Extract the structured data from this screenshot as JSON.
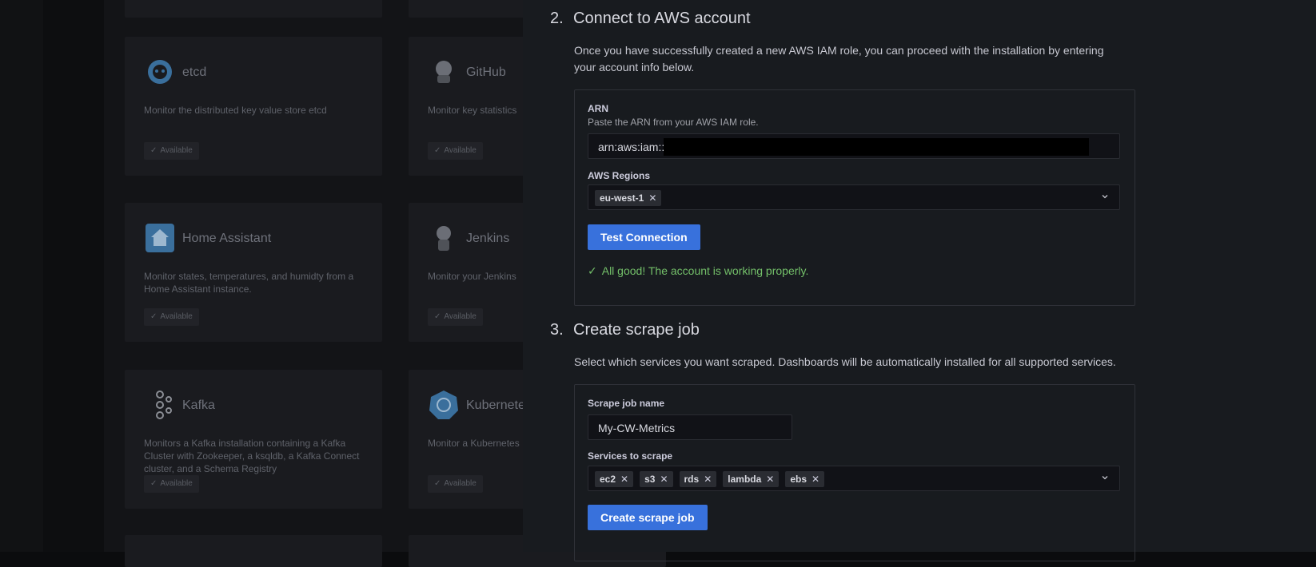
{
  "catalog": {
    "cards": [
      {
        "title": "etcd",
        "desc": "Monitor the distributed key value store etcd",
        "badge": "Available"
      },
      {
        "title": "GitHub",
        "desc": "Monitor key statistics",
        "badge": "Available"
      },
      {
        "title": "Home Assistant",
        "desc": "Monitor states, temperatures, and humidty from a Home Assistant instance.",
        "badge": "Available"
      },
      {
        "title": "Jenkins",
        "desc": "Monitor your Jenkins",
        "badge": "Available"
      },
      {
        "title": "Kafka",
        "desc": "Monitors a Kafka installation containing a Kafka Cluster with Zookeeper, a ksqldb, a Kafka Connect cluster, and a Schema Registry",
        "badge": "Available"
      },
      {
        "title": "Kubernete",
        "desc": "Monitor a Kubernetes",
        "badge": "Available"
      }
    ]
  },
  "step2": {
    "number": "2.",
    "title": "Connect to AWS account",
    "description": "Once you have successfully created a new AWS IAM role, you can proceed with the installation by entering your account info below.",
    "arn_label": "ARN",
    "arn_hint": "Paste the ARN from your AWS IAM role.",
    "arn_value": "arn:aws:iam::",
    "regions_label": "AWS Regions",
    "regions": [
      "eu-west-1"
    ],
    "test_button": "Test Connection",
    "success_message": "All good! The account is working properly."
  },
  "step3": {
    "number": "3.",
    "title": "Create scrape job",
    "description": "Select which services you want scraped. Dashboards will be automatically installed for all supported services.",
    "job_name_label": "Scrape job name",
    "job_name_value": "My-CW-Metrics",
    "services_label": "Services to scrape",
    "services": [
      "ec2",
      "s3",
      "rds",
      "lambda",
      "ebs"
    ],
    "create_button": "Create scrape job"
  },
  "colors": {
    "accent": "#3871dc",
    "success": "#73bf69",
    "drawer_bg": "#181b1f"
  }
}
